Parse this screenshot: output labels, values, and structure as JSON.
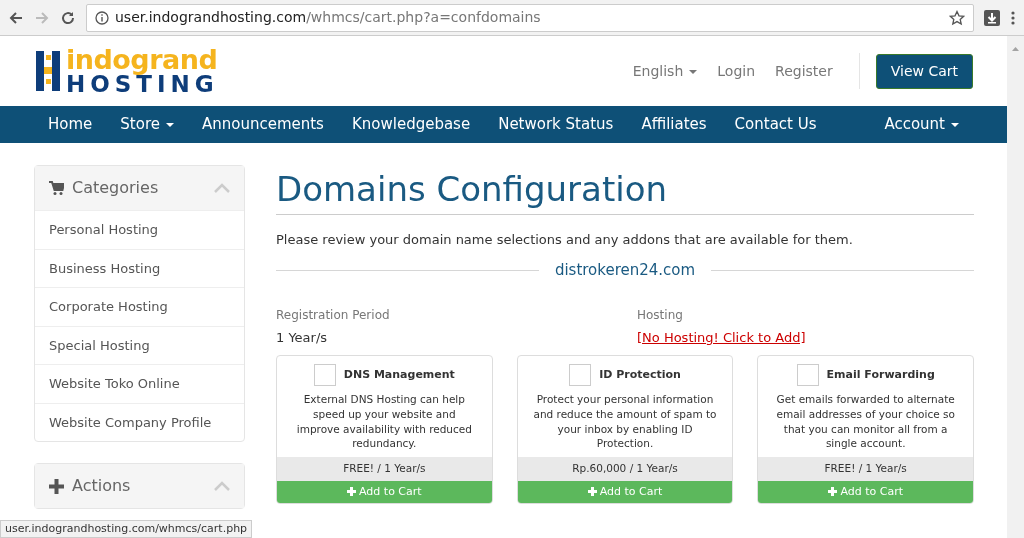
{
  "browser": {
    "url_host": "user.indograndhosting.com",
    "url_path": "/whmcs/cart.php?a=confdomains",
    "status_url": "user.indograndhosting.com/whmcs/cart.php"
  },
  "logo": {
    "line1": "indogrand",
    "line2": "HOSTING"
  },
  "header_links": [
    {
      "label": "English",
      "dropdown": true
    },
    {
      "label": "Login",
      "dropdown": false
    },
    {
      "label": "Register",
      "dropdown": false
    }
  ],
  "view_cart": "View Cart",
  "nav": [
    {
      "label": "Home",
      "dropdown": false
    },
    {
      "label": "Store",
      "dropdown": true
    },
    {
      "label": "Announcements",
      "dropdown": false
    },
    {
      "label": "Knowledgebase",
      "dropdown": false
    },
    {
      "label": "Network Status",
      "dropdown": false
    },
    {
      "label": "Affiliates",
      "dropdown": false
    },
    {
      "label": "Contact Us",
      "dropdown": false
    }
  ],
  "nav_right": {
    "label": "Account",
    "dropdown": true
  },
  "sidebar": [
    {
      "title": "Categories",
      "items": [
        "Personal Hosting",
        "Business Hosting",
        "Corporate Hosting",
        "Special Hosting",
        "Website Toko Online",
        "Website Company Profile"
      ]
    },
    {
      "title": "Actions"
    }
  ],
  "heading": "Domains Configuration",
  "intro": "Please review your domain name selections and any addons that are available for them.",
  "domain": "distrokeren24.com",
  "fields": [
    {
      "label": "Registration Period",
      "value": "1 Year/s",
      "kind": "text"
    },
    {
      "label": "Hosting",
      "value": "[No Hosting! Click to Add]",
      "kind": "link"
    }
  ],
  "addons": [
    {
      "name": "DNS Management",
      "checked": false,
      "description": "External DNS Hosting can help speed up your website and improve availability with reduced redundancy.",
      "price": "FREE! / 1 Year/s",
      "button": "Add to Cart"
    },
    {
      "name": "ID Protection",
      "checked": false,
      "description": "Protect your personal information and reduce the amount of spam to your inbox by enabling ID Protection.",
      "price": "Rp.60,000 / 1 Year/s",
      "button": "Add to Cart"
    },
    {
      "name": "Email Forwarding",
      "checked": false,
      "description": "Get emails forwarded to alternate email addresses of your choice so that you can monitor all from a single account.",
      "price": "FREE! / 1 Year/s",
      "button": "Add to Cart"
    }
  ]
}
